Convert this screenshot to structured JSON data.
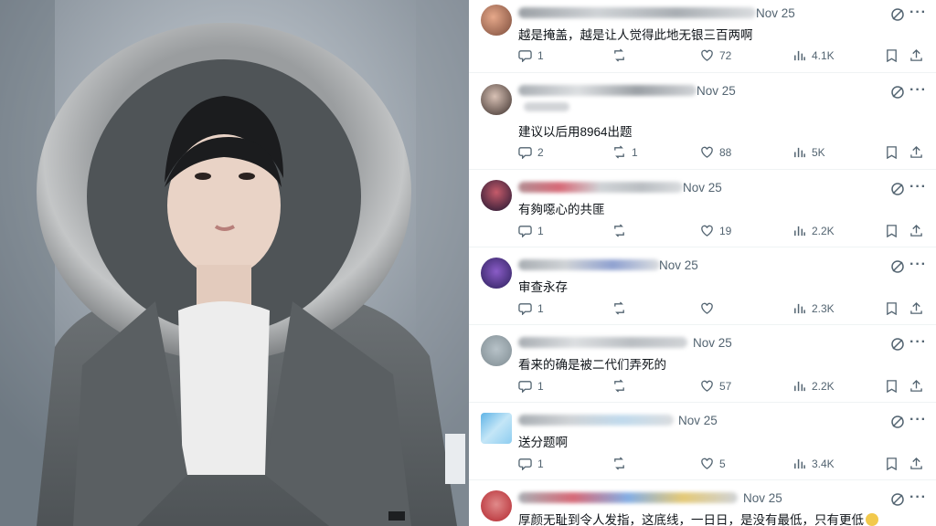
{
  "replies": [
    {
      "date": "Nov 25",
      "text": "越是掩盖，越是让人觉得此地无银三百两啊",
      "reply_count": "1",
      "retweet_count": "",
      "like_count": "72",
      "view_count": "4.1K"
    },
    {
      "date": "Nov 25",
      "text": "建议以后用8964出题",
      "reply_count": "2",
      "retweet_count": "1",
      "like_count": "88",
      "view_count": "5K"
    },
    {
      "date": "Nov 25",
      "text": "有夠噁心的共匪",
      "reply_count": "1",
      "retweet_count": "",
      "like_count": "19",
      "view_count": "2.2K"
    },
    {
      "date": "Nov 25",
      "text": "审查永存",
      "reply_count": "1",
      "retweet_count": "",
      "like_count": "",
      "view_count": "2.3K"
    },
    {
      "date": "Nov 25",
      "text": "看来的确是被二代们弄死的",
      "reply_count": "1",
      "retweet_count": "",
      "like_count": "57",
      "view_count": "2.2K"
    },
    {
      "date": "Nov 25",
      "text": "送分题啊",
      "reply_count": "1",
      "retweet_count": "",
      "like_count": "5",
      "view_count": "3.4K"
    },
    {
      "date": "Nov 25",
      "text": "厚颜无耻到令人发指，这底线，一日日，是没有最低，只有更低",
      "reply_count": "",
      "retweet_count": "",
      "like_count": "",
      "view_count": ""
    }
  ],
  "colors": {
    "text": "#0f1419",
    "muted": "#536471",
    "divider": "#eff3f4",
    "emoji": "#f2c94c"
  },
  "icons": [
    "reply-icon",
    "retweet-icon",
    "like-icon",
    "views-icon",
    "bookmark-icon",
    "share-icon",
    "grok-icon",
    "more-icon"
  ]
}
